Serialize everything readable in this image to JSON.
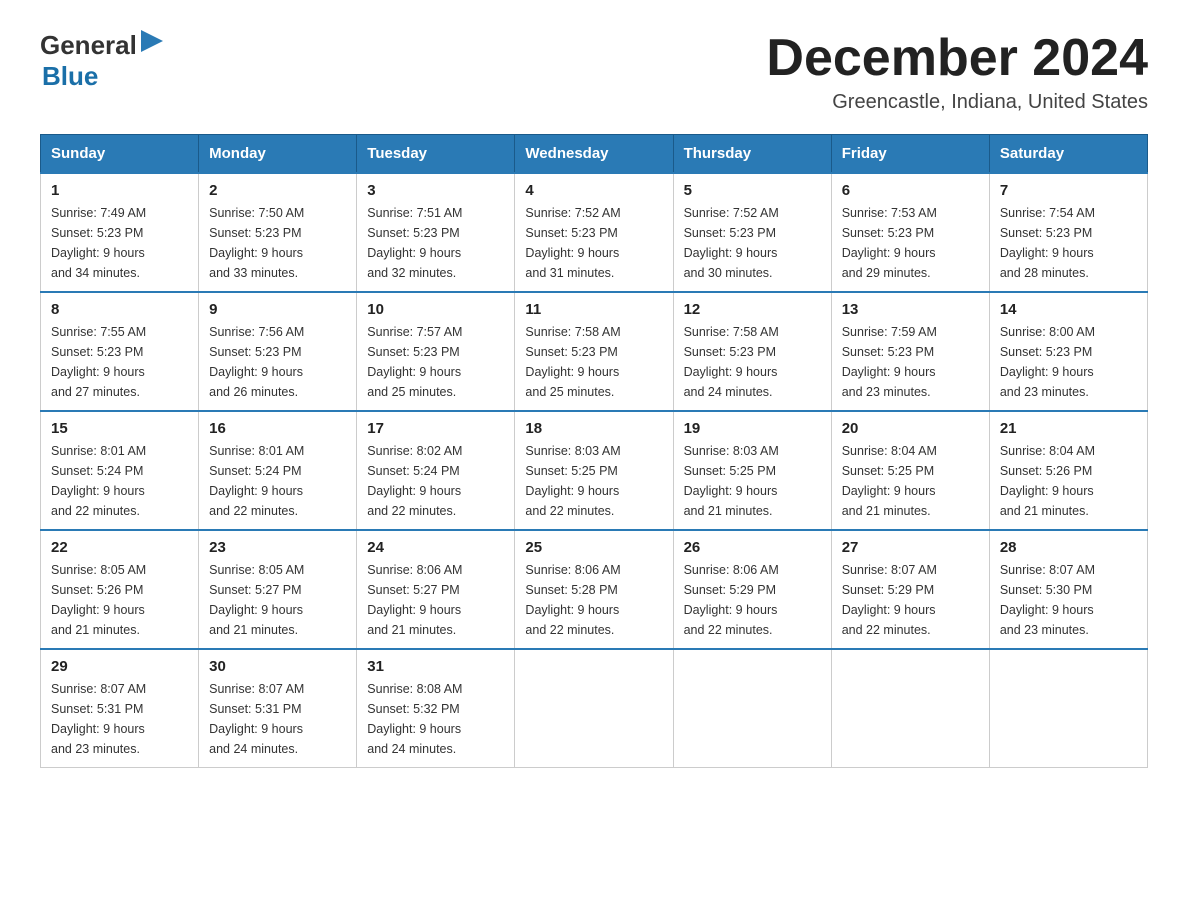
{
  "header": {
    "logo_general": "General",
    "logo_blue": "Blue",
    "title": "December 2024",
    "subtitle": "Greencastle, Indiana, United States"
  },
  "days_of_week": [
    "Sunday",
    "Monday",
    "Tuesday",
    "Wednesday",
    "Thursday",
    "Friday",
    "Saturday"
  ],
  "weeks": [
    [
      {
        "day": "1",
        "sunrise": "7:49 AM",
        "sunset": "5:23 PM",
        "daylight": "9 hours and 34 minutes."
      },
      {
        "day": "2",
        "sunrise": "7:50 AM",
        "sunset": "5:23 PM",
        "daylight": "9 hours and 33 minutes."
      },
      {
        "day": "3",
        "sunrise": "7:51 AM",
        "sunset": "5:23 PM",
        "daylight": "9 hours and 32 minutes."
      },
      {
        "day": "4",
        "sunrise": "7:52 AM",
        "sunset": "5:23 PM",
        "daylight": "9 hours and 31 minutes."
      },
      {
        "day": "5",
        "sunrise": "7:52 AM",
        "sunset": "5:23 PM",
        "daylight": "9 hours and 30 minutes."
      },
      {
        "day": "6",
        "sunrise": "7:53 AM",
        "sunset": "5:23 PM",
        "daylight": "9 hours and 29 minutes."
      },
      {
        "day": "7",
        "sunrise": "7:54 AM",
        "sunset": "5:23 PM",
        "daylight": "9 hours and 28 minutes."
      }
    ],
    [
      {
        "day": "8",
        "sunrise": "7:55 AM",
        "sunset": "5:23 PM",
        "daylight": "9 hours and 27 minutes."
      },
      {
        "day": "9",
        "sunrise": "7:56 AM",
        "sunset": "5:23 PM",
        "daylight": "9 hours and 26 minutes."
      },
      {
        "day": "10",
        "sunrise": "7:57 AM",
        "sunset": "5:23 PM",
        "daylight": "9 hours and 25 minutes."
      },
      {
        "day": "11",
        "sunrise": "7:58 AM",
        "sunset": "5:23 PM",
        "daylight": "9 hours and 25 minutes."
      },
      {
        "day": "12",
        "sunrise": "7:58 AM",
        "sunset": "5:23 PM",
        "daylight": "9 hours and 24 minutes."
      },
      {
        "day": "13",
        "sunrise": "7:59 AM",
        "sunset": "5:23 PM",
        "daylight": "9 hours and 23 minutes."
      },
      {
        "day": "14",
        "sunrise": "8:00 AM",
        "sunset": "5:23 PM",
        "daylight": "9 hours and 23 minutes."
      }
    ],
    [
      {
        "day": "15",
        "sunrise": "8:01 AM",
        "sunset": "5:24 PM",
        "daylight": "9 hours and 22 minutes."
      },
      {
        "day": "16",
        "sunrise": "8:01 AM",
        "sunset": "5:24 PM",
        "daylight": "9 hours and 22 minutes."
      },
      {
        "day": "17",
        "sunrise": "8:02 AM",
        "sunset": "5:24 PM",
        "daylight": "9 hours and 22 minutes."
      },
      {
        "day": "18",
        "sunrise": "8:03 AM",
        "sunset": "5:25 PM",
        "daylight": "9 hours and 22 minutes."
      },
      {
        "day": "19",
        "sunrise": "8:03 AM",
        "sunset": "5:25 PM",
        "daylight": "9 hours and 21 minutes."
      },
      {
        "day": "20",
        "sunrise": "8:04 AM",
        "sunset": "5:25 PM",
        "daylight": "9 hours and 21 minutes."
      },
      {
        "day": "21",
        "sunrise": "8:04 AM",
        "sunset": "5:26 PM",
        "daylight": "9 hours and 21 minutes."
      }
    ],
    [
      {
        "day": "22",
        "sunrise": "8:05 AM",
        "sunset": "5:26 PM",
        "daylight": "9 hours and 21 minutes."
      },
      {
        "day": "23",
        "sunrise": "8:05 AM",
        "sunset": "5:27 PM",
        "daylight": "9 hours and 21 minutes."
      },
      {
        "day": "24",
        "sunrise": "8:06 AM",
        "sunset": "5:27 PM",
        "daylight": "9 hours and 21 minutes."
      },
      {
        "day": "25",
        "sunrise": "8:06 AM",
        "sunset": "5:28 PM",
        "daylight": "9 hours and 22 minutes."
      },
      {
        "day": "26",
        "sunrise": "8:06 AM",
        "sunset": "5:29 PM",
        "daylight": "9 hours and 22 minutes."
      },
      {
        "day": "27",
        "sunrise": "8:07 AM",
        "sunset": "5:29 PM",
        "daylight": "9 hours and 22 minutes."
      },
      {
        "day": "28",
        "sunrise": "8:07 AM",
        "sunset": "5:30 PM",
        "daylight": "9 hours and 23 minutes."
      }
    ],
    [
      {
        "day": "29",
        "sunrise": "8:07 AM",
        "sunset": "5:31 PM",
        "daylight": "9 hours and 23 minutes."
      },
      {
        "day": "30",
        "sunrise": "8:07 AM",
        "sunset": "5:31 PM",
        "daylight": "9 hours and 24 minutes."
      },
      {
        "day": "31",
        "sunrise": "8:08 AM",
        "sunset": "5:32 PM",
        "daylight": "9 hours and 24 minutes."
      },
      null,
      null,
      null,
      null
    ]
  ],
  "labels": {
    "sunrise": "Sunrise:",
    "sunset": "Sunset:",
    "daylight": "Daylight:"
  }
}
